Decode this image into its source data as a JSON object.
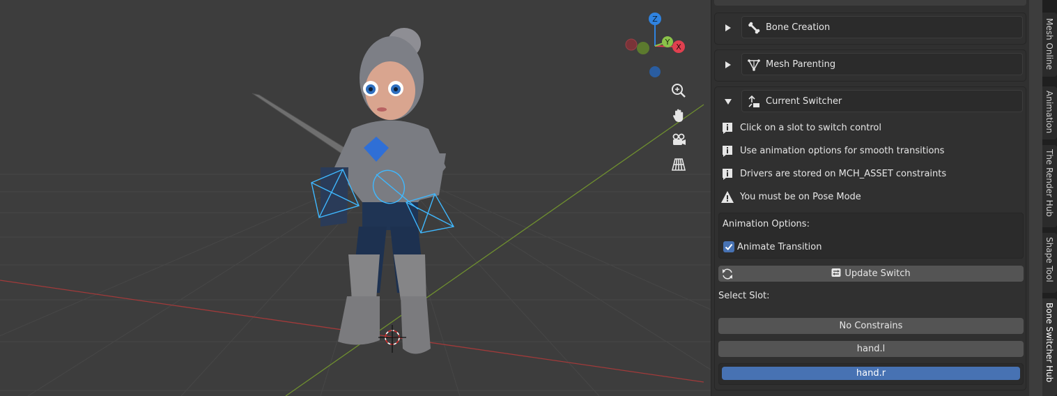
{
  "panel": {
    "sections": [
      {
        "label": "Bone Creation",
        "expanded": false,
        "icon": "bone-icon"
      },
      {
        "label": "Mesh Parenting",
        "expanded": false,
        "icon": "mesh-icon"
      },
      {
        "label": "Current Switcher",
        "expanded": true,
        "icon": "switch-icon"
      }
    ],
    "info": [
      {
        "text": "Click on a slot to switch control",
        "icon": "info-icon"
      },
      {
        "text": "Use animation options for smooth transitions",
        "icon": "info-icon"
      },
      {
        "text": "Drivers are stored on MCH_ASSET constraints",
        "icon": "info-icon"
      },
      {
        "text": "You must be on Pose Mode",
        "icon": "warning-icon"
      }
    ],
    "animation_options_label": "Animation Options:",
    "animate_transition": {
      "label": "Animate Transition",
      "checked": true
    },
    "update_switch_label": "Update Switch",
    "select_slot_label": "Select Slot:",
    "slots": [
      {
        "label": "No Constrains",
        "active": false
      },
      {
        "label": "hand.l",
        "active": false
      },
      {
        "label": "hand.r",
        "active": true
      }
    ]
  },
  "tabs": [
    "Mesh Online",
    "Animation",
    "The Render Hub",
    "Shape Tool",
    "Bone Switcher Hub"
  ],
  "active_tab": "Bone Switcher Hub",
  "gizmo": {
    "axes": [
      "Z",
      "Y",
      "X"
    ]
  },
  "colors": {
    "accent": "#4772b3",
    "axis_x": "#e0404f",
    "axis_y": "#8bc34a",
    "axis_z": "#2f83e0",
    "bone_wire": "#3fb8ff"
  }
}
